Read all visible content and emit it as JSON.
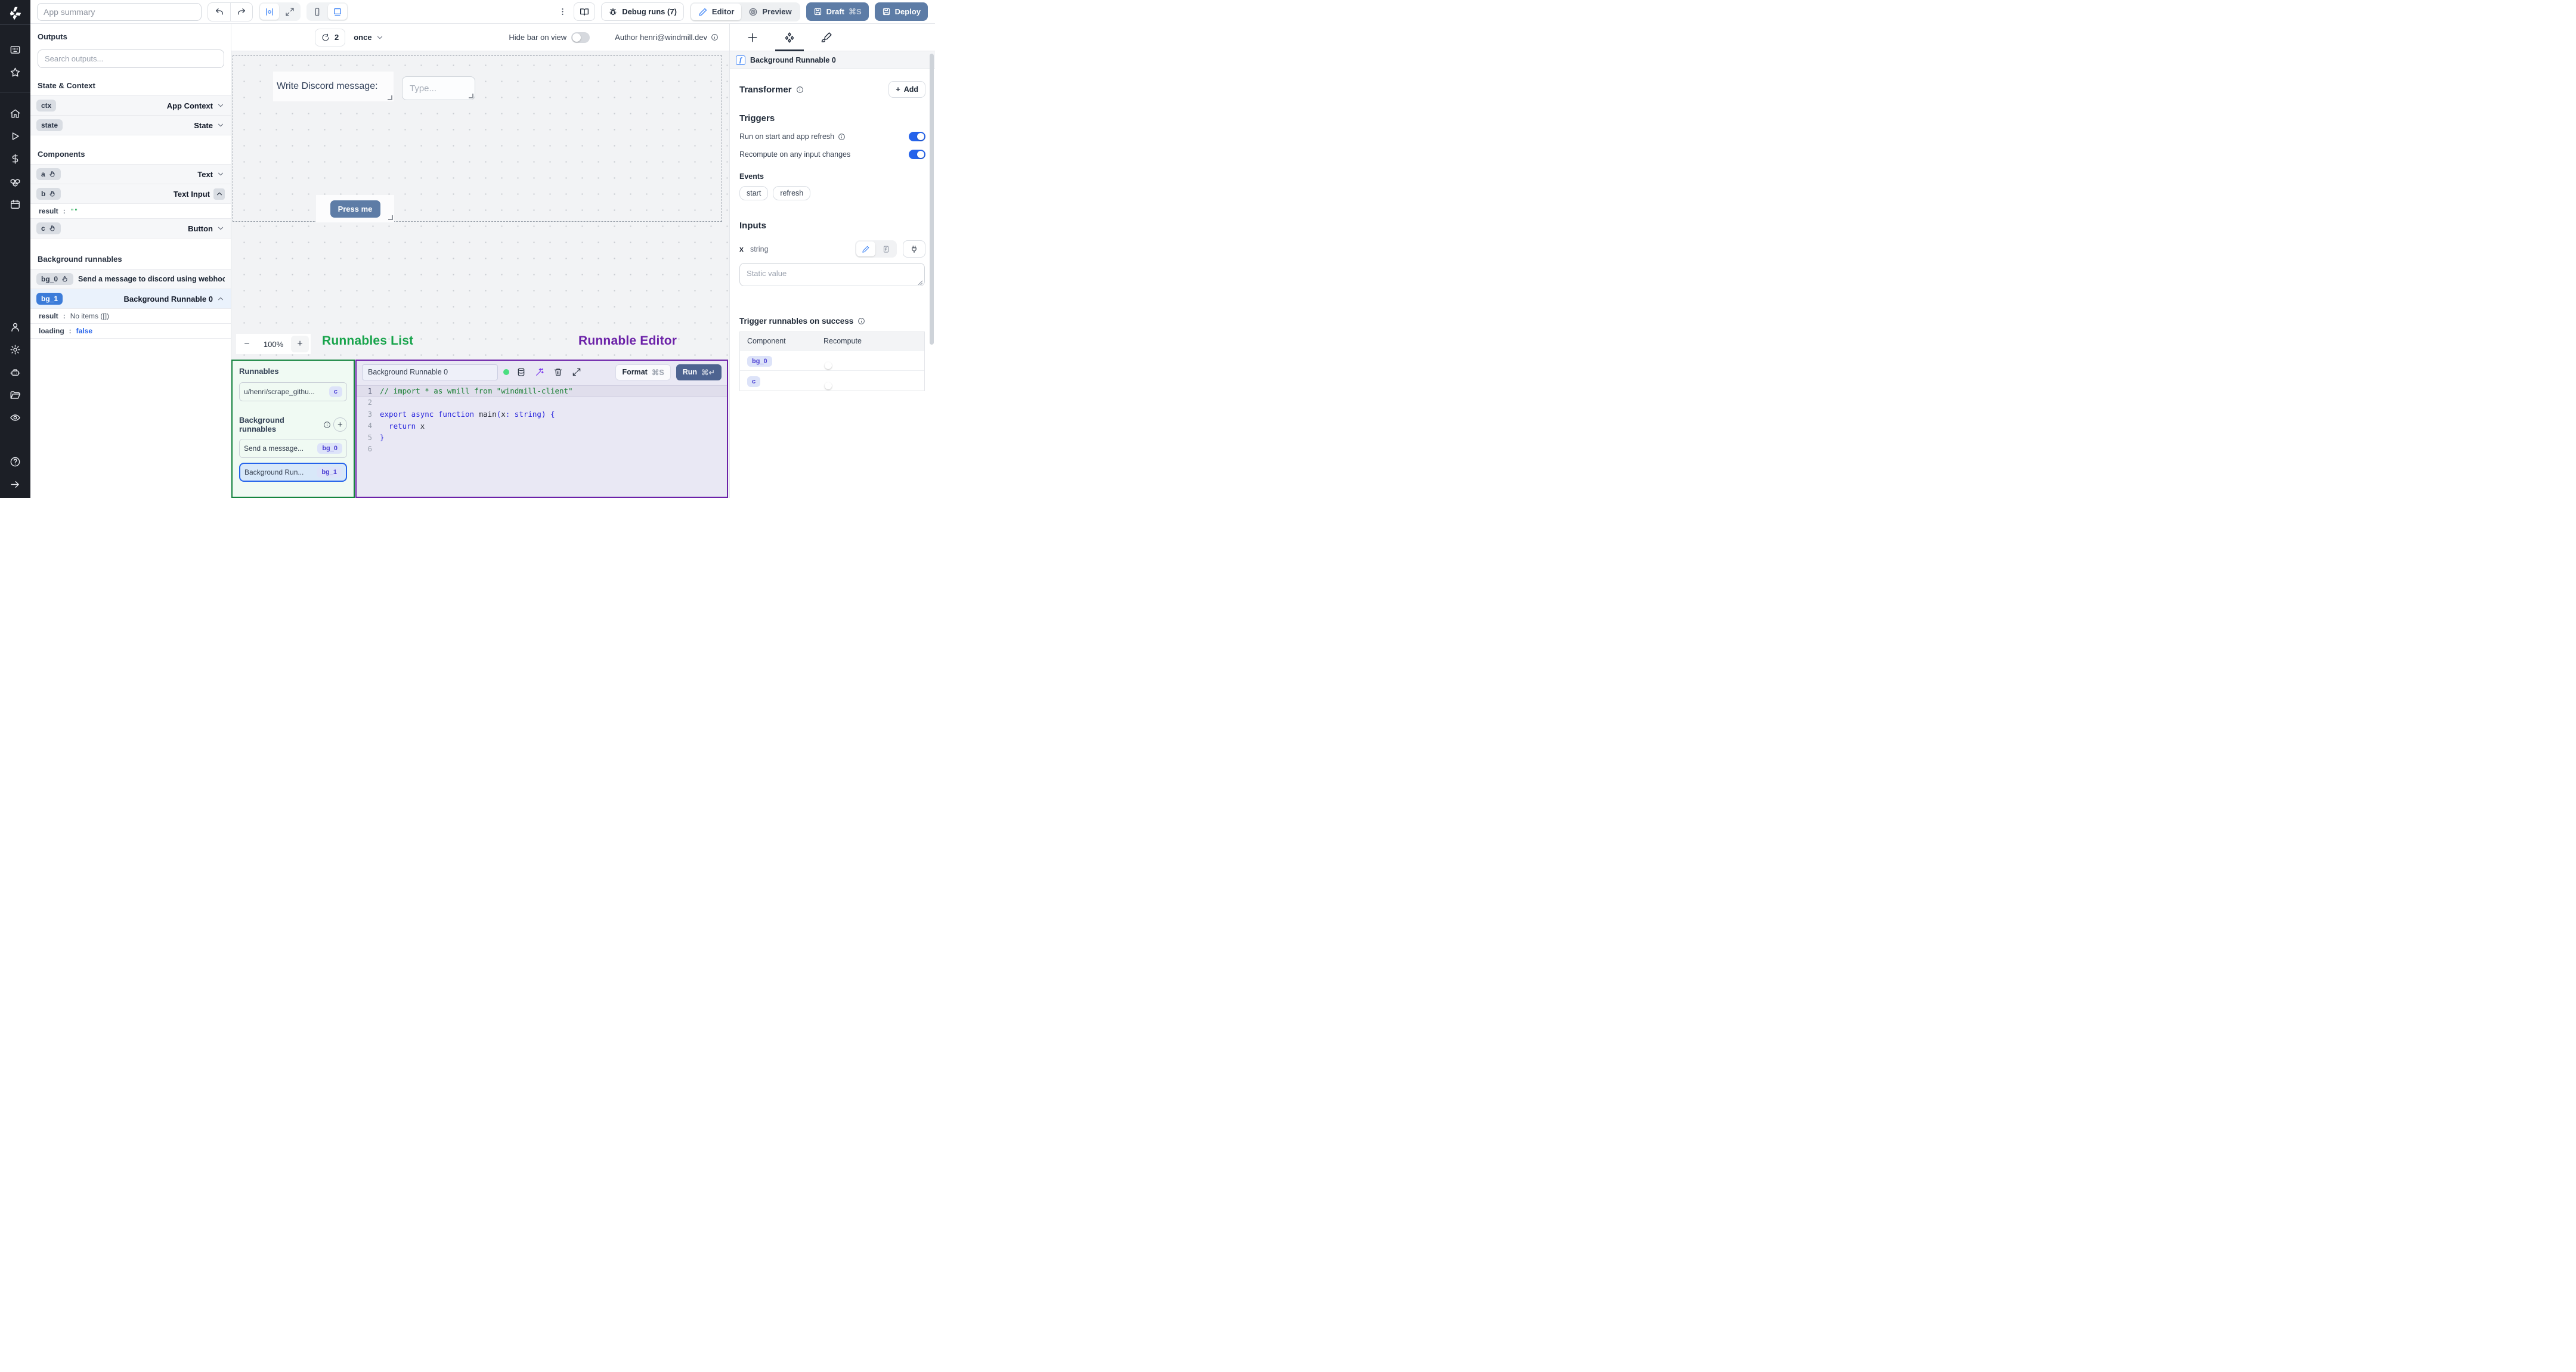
{
  "topbar": {
    "summary_placeholder": "App summary",
    "debug_runs_label": "Debug runs (7)",
    "editor_label": "Editor",
    "preview_label": "Preview",
    "draft_label": "Draft",
    "draft_shortcut": "⌘S",
    "deploy_label": "Deploy"
  },
  "left_panel": {
    "title": "Outputs",
    "search_placeholder": "Search outputs...",
    "state_context": {
      "title": "State & Context",
      "rows": [
        {
          "id": "ctx",
          "type": "App Context"
        },
        {
          "id": "state",
          "type": "State"
        }
      ]
    },
    "components": {
      "title": "Components",
      "row_a": {
        "id": "a",
        "type": "Text"
      },
      "row_b": {
        "id": "b",
        "type": "Text Input"
      },
      "b_expanded": {
        "key": "result",
        "colon": ":",
        "value": "\"\""
      },
      "row_c": {
        "id": "c",
        "type": "Button"
      }
    },
    "background_runnables": {
      "title": "Background runnables",
      "bg0": {
        "id": "bg_0",
        "name": "Send a message to discord using webhoo"
      },
      "bg1": {
        "id": "bg_1",
        "name": "Background Runnable 0"
      },
      "bg1_expanded": {
        "result_key": "result",
        "colon": ":",
        "result_value": "No items ([])",
        "loading_key": "loading",
        "loading_value": "false"
      }
    }
  },
  "canvas": {
    "header": {
      "refresh_count": "2",
      "interval": "once",
      "hide_bar_label": "Hide bar on view",
      "author_label": "Author henri@windmill.dev"
    },
    "zoom": {
      "out": "−",
      "level": "100%",
      "in": "+"
    },
    "components": {
      "text_label": "Write Discord message:",
      "input_placeholder": "Type...",
      "button_label": "Press me"
    }
  },
  "annotations": {
    "runnables_list": "Runnables List",
    "runnable_editor": "Runnable Editor"
  },
  "runnables_panel": {
    "title": "Runnables",
    "item": {
      "name": "u/henri/scrape_githu...",
      "badge": "c"
    },
    "bg_title": "Background runnables",
    "add_label": "+",
    "items": [
      {
        "name": "Send a message...",
        "badge": "bg_0"
      },
      {
        "name": "Background Run...",
        "badge": "bg_1"
      }
    ]
  },
  "editor": {
    "name_value": "Background Runnable 0",
    "format_label": "Format",
    "format_shortcut": "⌘S",
    "run_label": "Run",
    "run_shortcut": "⌘↵",
    "code": {
      "lines": [
        {
          "num": "1",
          "comment": "// import * as wmill from \"windmill-client\""
        },
        {
          "num": "2"
        },
        {
          "num": "3",
          "k1": "export async function ",
          "p1": "main",
          "k2": "(",
          "p2": "x",
          "k3": ": string",
          "k4": ") {"
        },
        {
          "num": "4",
          "k1": "  return ",
          "p1": "x"
        },
        {
          "num": "5",
          "k1": "}"
        },
        {
          "num": "6"
        }
      ]
    }
  },
  "right_panel": {
    "header_title": "Background Runnable 0",
    "transformer": {
      "title": "Transformer",
      "add_label": "Add",
      "plus": "+"
    },
    "triggers": {
      "title": "Triggers",
      "run_on_start": "Run on start and app refresh",
      "recompute": "Recompute on any input changes",
      "events_label": "Events",
      "events": [
        "start",
        "refresh"
      ]
    },
    "inputs": {
      "title": "Inputs",
      "field_name": "x",
      "field_type": "string",
      "static_placeholder": "Static value"
    },
    "trigger_success": {
      "title": "Trigger runnables on success",
      "columns": [
        "Component",
        "Recompute"
      ],
      "rows": [
        {
          "badge": "bg_0"
        },
        {
          "badge": "c"
        }
      ]
    }
  },
  "colors": {
    "accent_blue": "#2563eb",
    "steel_blue": "#5d7ca6",
    "run_button": "#4d6390",
    "green_annotation": "#16a34a",
    "purple_annotation": "#6b21a8",
    "green_panel_border": "#15843f",
    "purple_panel_border": "#6b21a8",
    "selected_badge_blue": "#3c7cd9",
    "indigo_badge_text": "#4c40d4",
    "rail_background": "#1c1f26"
  }
}
